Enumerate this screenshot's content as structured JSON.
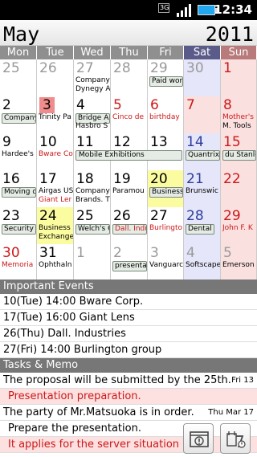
{
  "status": {
    "net": "3G",
    "time": "12:34"
  },
  "header": {
    "month": "May",
    "year": "2011"
  },
  "weekdays": [
    "Mon",
    "Tue",
    "Wed",
    "Thu",
    "Fri",
    "Sat",
    "Sun"
  ],
  "weeks": [
    [
      {
        "num": "25",
        "other": true
      },
      {
        "num": "26",
        "other": true
      },
      {
        "num": "27",
        "other": true,
        "events": [
          {
            "text": "Company"
          },
          {
            "text": "Dynegy A"
          }
        ]
      },
      {
        "num": "28",
        "other": true
      },
      {
        "num": "29",
        "other": true,
        "events": [
          {
            "text": "Paid wor",
            "box": true
          }
        ]
      },
      {
        "num": "30",
        "other": true,
        "col": "sat"
      },
      {
        "num": "1",
        "col": "sun",
        "red": true
      }
    ],
    [
      {
        "num": "2",
        "events": [
          {
            "text": "Company",
            "box": true
          }
        ]
      },
      {
        "num": "3",
        "hl": true,
        "events": [
          {
            "text": "Trinity Pa"
          }
        ]
      },
      {
        "num": "4",
        "events": [
          {
            "text": "Bridge Ai",
            "box": true
          },
          {
            "text": "Hasbro S"
          }
        ]
      },
      {
        "num": "5",
        "red": true,
        "events": [
          {
            "text": "Cinco de",
            "red": true
          }
        ]
      },
      {
        "num": "6",
        "red": true,
        "events": [
          {
            "text": "birthday",
            "red": true
          }
        ]
      },
      {
        "num": "7",
        "red": true,
        "col": "sun"
      },
      {
        "num": "8",
        "red": true,
        "col": "sun",
        "events": [
          {
            "text": "Mother's",
            "red": true
          },
          {
            "text": "M. Tools"
          }
        ]
      }
    ],
    [
      {
        "num": "9",
        "events": [
          {
            "text": "Hardee's"
          }
        ]
      },
      {
        "num": "10",
        "events": [
          {
            "text": "Bware Co",
            "red": true
          }
        ]
      },
      {
        "num": "11"
      },
      {
        "num": "12"
      },
      {
        "num": "13"
      },
      {
        "num": "14",
        "blue": true,
        "col": "sat",
        "events": [
          {
            "text": "Quantrix",
            "box": true
          }
        ]
      },
      {
        "num": "15",
        "red": true,
        "col": "sun",
        "events": [
          {
            "text": "du Stanle",
            "box": true
          }
        ]
      }
    ],
    [
      {
        "num": "16",
        "events": [
          {
            "text": "Moving d",
            "box": true
          }
        ]
      },
      {
        "num": "17",
        "events": [
          {
            "text": "Airgas US"
          },
          {
            "text": "Giant Ler",
            "red": true
          }
        ]
      },
      {
        "num": "18",
        "events": [
          {
            "text": "Company"
          },
          {
            "text": "Brands. T"
          }
        ]
      },
      {
        "num": "19",
        "events": [
          {
            "text": "Paramou"
          }
        ]
      },
      {
        "num": "20",
        "today": true,
        "events": [
          {
            "text": "Business",
            "box": true
          }
        ]
      },
      {
        "num": "21",
        "blue": true,
        "col": "sat",
        "events": [
          {
            "text": "Brunswic"
          }
        ]
      },
      {
        "num": "22",
        "red": true,
        "col": "sun"
      }
    ],
    [
      {
        "num": "23",
        "events": [
          {
            "text": "Security",
            "box": true
          }
        ]
      },
      {
        "num": "24",
        "today": true,
        "events": [
          {
            "text": "Business"
          },
          {
            "text": "Exchange"
          }
        ]
      },
      {
        "num": "25",
        "events": [
          {
            "text": "Welch's C",
            "box": true
          }
        ]
      },
      {
        "num": "26",
        "events": [
          {
            "text": "Dall. Indu",
            "red": true,
            "box": true
          }
        ]
      },
      {
        "num": "27",
        "events": [
          {
            "text": "Burlingto",
            "red": true
          }
        ]
      },
      {
        "num": "28",
        "blue": true,
        "col": "sat",
        "events": [
          {
            "text": "Dental",
            "box": true
          }
        ]
      },
      {
        "num": "29",
        "red": true,
        "col": "sun",
        "events": [
          {
            "text": "John F. K",
            "red": true
          }
        ]
      }
    ],
    [
      {
        "num": "30",
        "red": true,
        "events": [
          {
            "text": "Memoria",
            "red": true
          }
        ]
      },
      {
        "num": "31",
        "events": [
          {
            "text": "Ophthaln"
          }
        ]
      },
      {
        "num": "1",
        "other": true
      },
      {
        "num": "2",
        "other": true,
        "events": [
          {
            "text": "presenta",
            "box": true
          }
        ]
      },
      {
        "num": "3",
        "other": true,
        "events": [
          {
            "text": "Vanguarc"
          }
        ]
      },
      {
        "num": "4",
        "other": true,
        "col": "sat",
        "events": [
          {
            "text": "Softscape"
          }
        ]
      },
      {
        "num": "5",
        "other": true,
        "col": "sun",
        "events": [
          {
            "text": "Emerson"
          }
        ]
      }
    ]
  ],
  "span_events": [
    {
      "text": "Mobile Exhibitions",
      "week": 2,
      "from": 2,
      "to": 4
    }
  ],
  "important": {
    "title": "Important Events",
    "items": [
      "10(Tue)  14:00  Bware Corp.",
      "17(Tue)  16:00  Giant Lens",
      "26(Thu)  Dall. Industries",
      "27(Fri)  14:00  Burlington group"
    ]
  },
  "tasks": {
    "title": "Tasks & Memo",
    "items": [
      {
        "text": "The proposal will be submitted by the 25th.",
        "date": "Fri 13"
      },
      {
        "text": "Presentation preparation.",
        "sub": true
      },
      {
        "text": "The party of Mr.Matsuoka is in order.",
        "date": "Thu Mar 17"
      },
      {
        "text": "Prepare the presentation.",
        "sub2": true
      },
      {
        "text": "It applies for the server situation",
        "sub": true
      }
    ]
  },
  "icons": {
    "alert": "alert-window-icon",
    "calendar": "calendar-day-icon"
  }
}
